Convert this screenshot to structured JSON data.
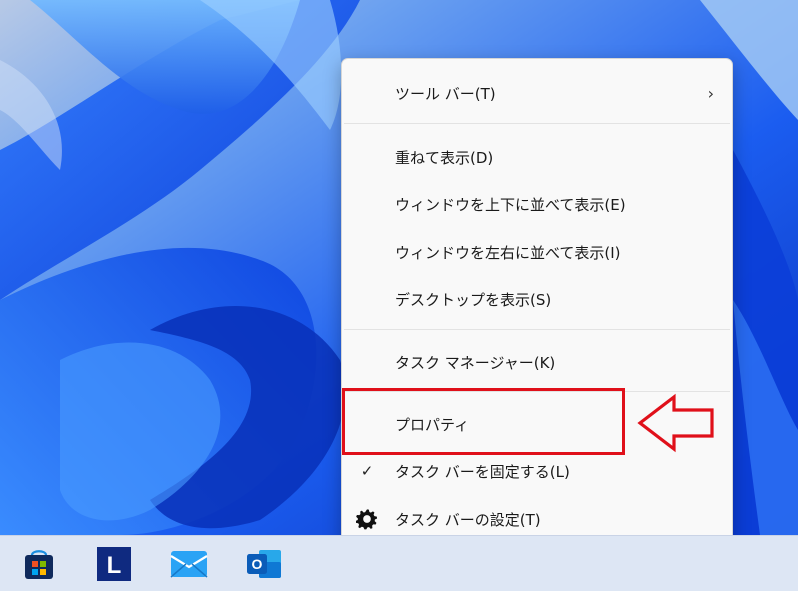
{
  "wallpaper": {
    "description_colors": [
      "#0b3fd8",
      "#1e6cff",
      "#4fa8ff",
      "#9fd0ff"
    ]
  },
  "context_menu": {
    "items": [
      {
        "label": "ツール バー(T)",
        "has_submenu": true
      },
      {
        "label": "重ねて表示(D)"
      },
      {
        "label": "ウィンドウを上下に並べて表示(E)"
      },
      {
        "label": "ウィンドウを左右に並べて表示(I)"
      },
      {
        "label": "デスクトップを表示(S)"
      },
      {
        "label": "タスク マネージャー(K)"
      },
      {
        "label": "プロパティ",
        "highlighted": true
      },
      {
        "label": "タスク バーを固定する(L)",
        "checked": true,
        "check_glyph": "✓"
      },
      {
        "label": "タスク バーの設定(T)",
        "icon": "gear-icon"
      }
    ],
    "submenu_glyph": "›"
  },
  "annotation": {
    "box_color": "#e0101a",
    "arrow_color": "#e0101a"
  },
  "taskbar": {
    "icons": [
      {
        "name": "microsoft-store-icon"
      },
      {
        "name": "l-app-icon",
        "letter": "L"
      },
      {
        "name": "mail-icon"
      },
      {
        "name": "outlook-icon",
        "letter": "O"
      }
    ]
  }
}
